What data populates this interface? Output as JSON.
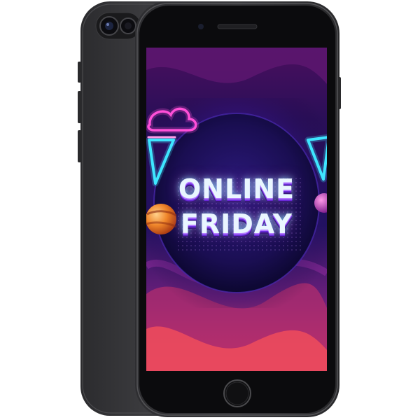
{
  "device": {
    "kind": "smartphone",
    "finish": "space-gray",
    "body_color": "#2a2a2c",
    "frame_color": "#1b1b1d",
    "screen_color": "#050507"
  },
  "screen": {
    "headline": {
      "line1": "ONLINE",
      "line2": "FRIDAY"
    },
    "colors": {
      "background_top": "#3a1060",
      "background_bottom": "#e0436a",
      "neon_cyan": "#3ee6ff",
      "neon_magenta": "#ff4fd8",
      "planet_orange": "#f08a2a"
    }
  },
  "icons": {
    "front_camera": "front-camera-icon",
    "earpiece": "earpiece-speaker-icon",
    "home_button": "home-button-icon",
    "rear_camera": "rear-camera-icon"
  }
}
